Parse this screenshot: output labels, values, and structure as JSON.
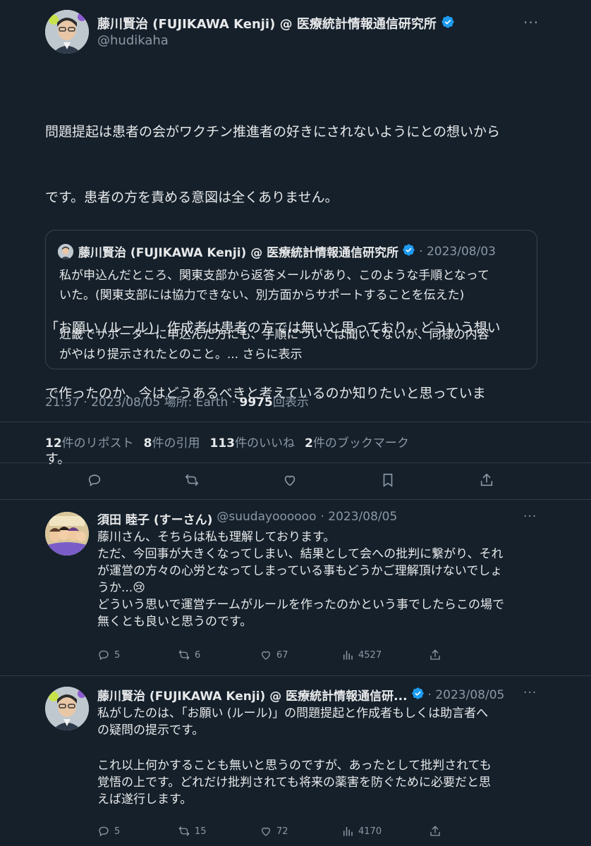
{
  "main_tweet": {
    "author_name": "藤川賢治 (FUJIKAWA Kenji) @ 医療統計情報通信研究所",
    "handle": "@hudikaha",
    "paragraph1_line1": "問題提起は患者の会がワクチン推進者の好きにされないようにとの想いから",
    "paragraph1_line2": "です。患者の方を責める意図は全くありません。",
    "paragraph2_line1": "「お願い (ルール)」作成者は患者の方では無いと思っており、どういう想い",
    "paragraph2_line2": "で作ったのか、今はどうあるべきと考えているのか知りたいと思っていま",
    "paragraph2_line3": "す。",
    "timestamp": "21:37 · 2023/08/05 場所: Earth ·",
    "views_count": "9975",
    "views_label": "回表示"
  },
  "quoted_tweet": {
    "author_name": "藤川賢治 (FUJIKAWA Kenji) @ 医療統計情報通信研究所",
    "date": "· 2023/08/03",
    "line1": "私が申込んだところ、関東支部から返答メールがあり、このような手順となって",
    "line2": "いた。(関東支部には協力できない、別方面からサポートすることを伝えた)",
    "line3": "近畿でサポーターに申込んだ方にも、手順については聞いてないが、同様の内容",
    "line4": "がやはり提示されたとのこと。...",
    "show_more": "さらに表示"
  },
  "stats": {
    "reposts_count": "12",
    "reposts_label": "件のリポスト",
    "quotes_count": "8",
    "quotes_label": "件の引用",
    "likes_count": "113",
    "likes_label": "件のいいね",
    "bookmarks_count": "2",
    "bookmarks_label": "件のブックマーク"
  },
  "action_icons": [
    "reply-icon",
    "repost-icon",
    "like-icon",
    "bookmark-icon",
    "share-icon"
  ],
  "replies": [
    {
      "author_name": "須田 睦子 (すーさん)",
      "handle": "@suudayoooooo",
      "date": "· 2023/08/05",
      "line1": "藤川さん、そちらは私も理解しております。",
      "line2": "ただ、今回事が大きくなってしまい、結果として会への批判に繋がり、それ",
      "line3": "が運営の方々の心労となってしまっている事もどうかご理解頂けないでしょ",
      "line4": "うか...😢",
      "line5": "どういう思いで運営チームがルールを作ったのかという事でしたらこの場で",
      "line6": "無くとも良いと思うのです。",
      "replies_count": "5",
      "reposts_count": "6",
      "likes_count": "67",
      "views_count": "4527"
    },
    {
      "author_name": "藤川賢治 (FUJIKAWA Kenji) @ 医療統計情報通信研...",
      "date": "· 2023/08/05",
      "line1": "私がしたのは、「お願い (ルール)」の問題提起と作成者もしくは助言者へ",
      "line2": "の疑問の提示です。",
      "line3": "これ以上何かすることも無いと思うのですが、あったとして批判されても",
      "line4": "覚悟の上です。どれだけ批判されても将来の薬害を防ぐために必要だと思",
      "line5": "えば遂行します。",
      "replies_count": "5",
      "reposts_count": "15",
      "likes_count": "72",
      "views_count": "4170"
    }
  ],
  "colors": {
    "background": "#15202b",
    "text": "#e7e9ea",
    "muted": "#8b98a5",
    "verified_blue": "#1d9bf0",
    "divider": "#2f3b47"
  }
}
